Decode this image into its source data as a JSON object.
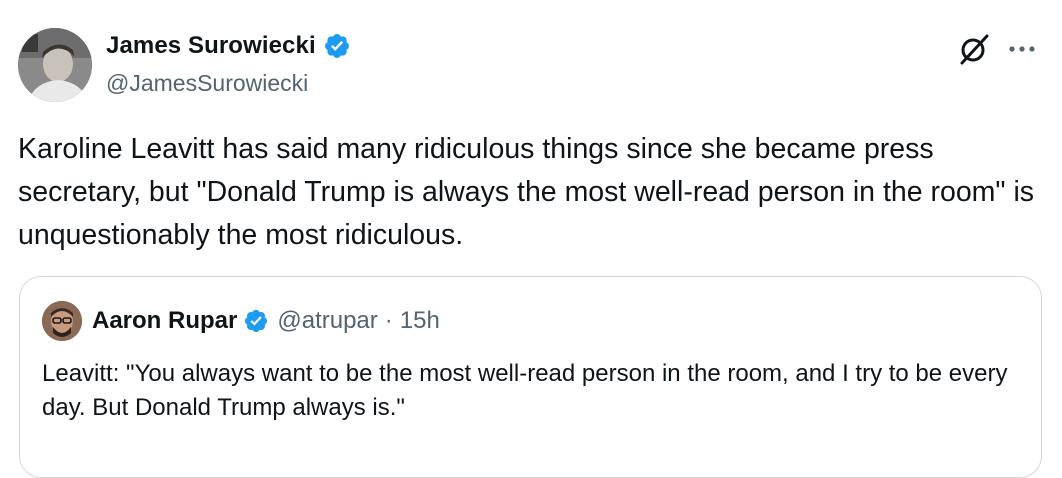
{
  "tweet": {
    "author": {
      "name": "James Surowiecki",
      "handle": "@JamesSurowiecki",
      "verified": true
    },
    "text": "Karoline Leavitt has said many ridiculous things since she became press secretary, but \"Donald Trump is always the most well-read person in the room\" is unquestionably the most ridiculous.",
    "icons": {
      "grok": "grok-icon",
      "more": "more-icon",
      "verified": "verified-badge-icon"
    },
    "colors": {
      "verified": "#1d9bf0",
      "secondary_text": "#536471",
      "primary_text": "#0f1419",
      "border": "#cfd9de"
    }
  },
  "quote": {
    "author": {
      "name": "Aaron Rupar",
      "handle": "@atrupar",
      "verified": true
    },
    "separator": "·",
    "time": "15h",
    "text": "Leavitt: \"You always want to be the most well-read person in the room, and I try to be every day. But Donald Trump always is.\""
  }
}
